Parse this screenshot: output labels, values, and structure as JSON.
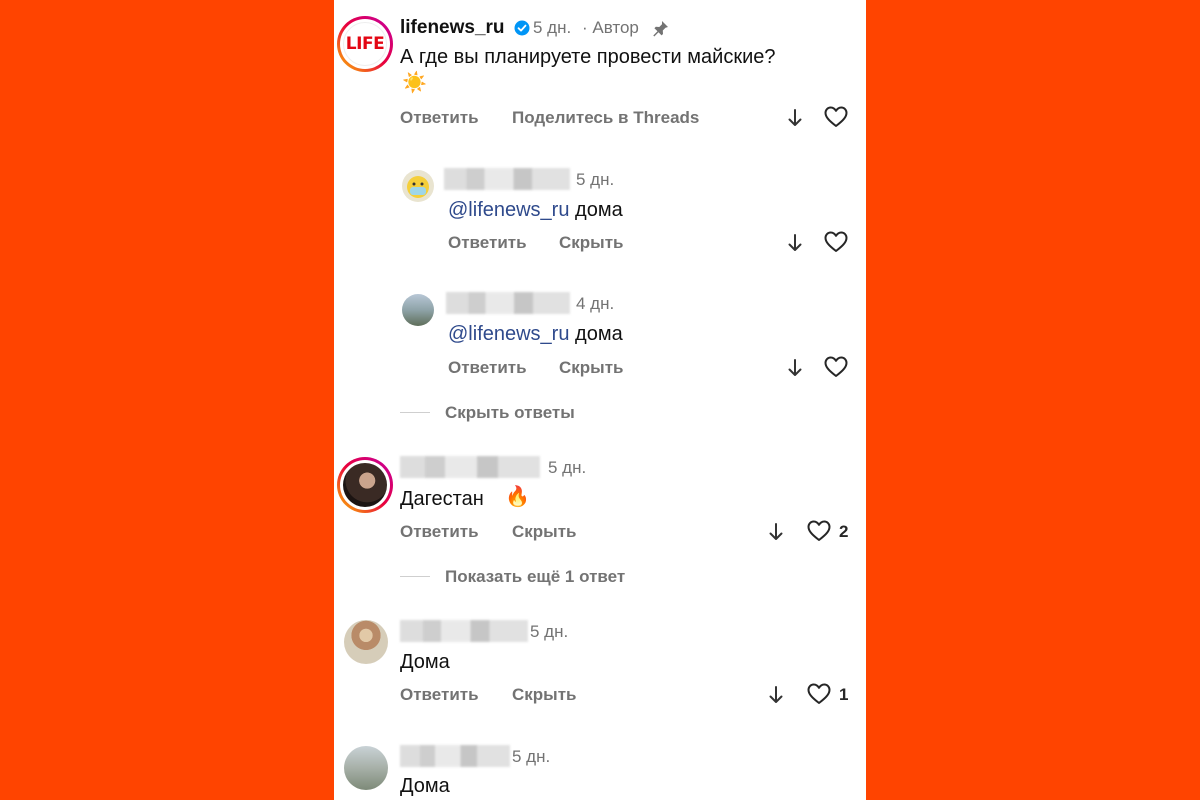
{
  "main_comment": {
    "username": "lifenews_ru",
    "time": "5 дн.",
    "author_meta": "· Автор",
    "text": "А где вы планируете провести майские?",
    "emoji": "☀️",
    "reply_label": "Ответить",
    "share_label": "Поделитесь в Threads",
    "avatar_text": "LIFE"
  },
  "replies": [
    {
      "time": "5 дн.",
      "mention": "@lifenews_ru",
      "text": " дома",
      "reply_label": "Ответить",
      "hide_label": "Скрыть"
    },
    {
      "time": "4 дн.",
      "mention": "@lifenews_ru",
      "text": " дома",
      "reply_label": "Ответить",
      "hide_label": "Скрыть"
    }
  ],
  "hide_replies_label": "Скрыть ответы",
  "comments": [
    {
      "time": "5 дн.",
      "text": "Дагестан",
      "emoji": "🔥",
      "reply_label": "Ответить",
      "hide_label": "Скрыть",
      "likes": "2"
    },
    {
      "time": "5 дн.",
      "text": "Дома",
      "reply_label": "Ответить",
      "hide_label": "Скрыть",
      "likes": "1"
    },
    {
      "time": "5 дн.",
      "text": "Дома"
    }
  ],
  "show_more_label": "Показать ещё 1 ответ",
  "icons": {
    "verified": "verified-badge-icon",
    "pin": "pin-icon",
    "arrow_down": "arrow-down-icon",
    "heart": "heart-icon"
  },
  "colors": {
    "background": "#ff4400",
    "verified": "#0095f6",
    "mention": "#2f4a8c",
    "muted": "#737373"
  }
}
